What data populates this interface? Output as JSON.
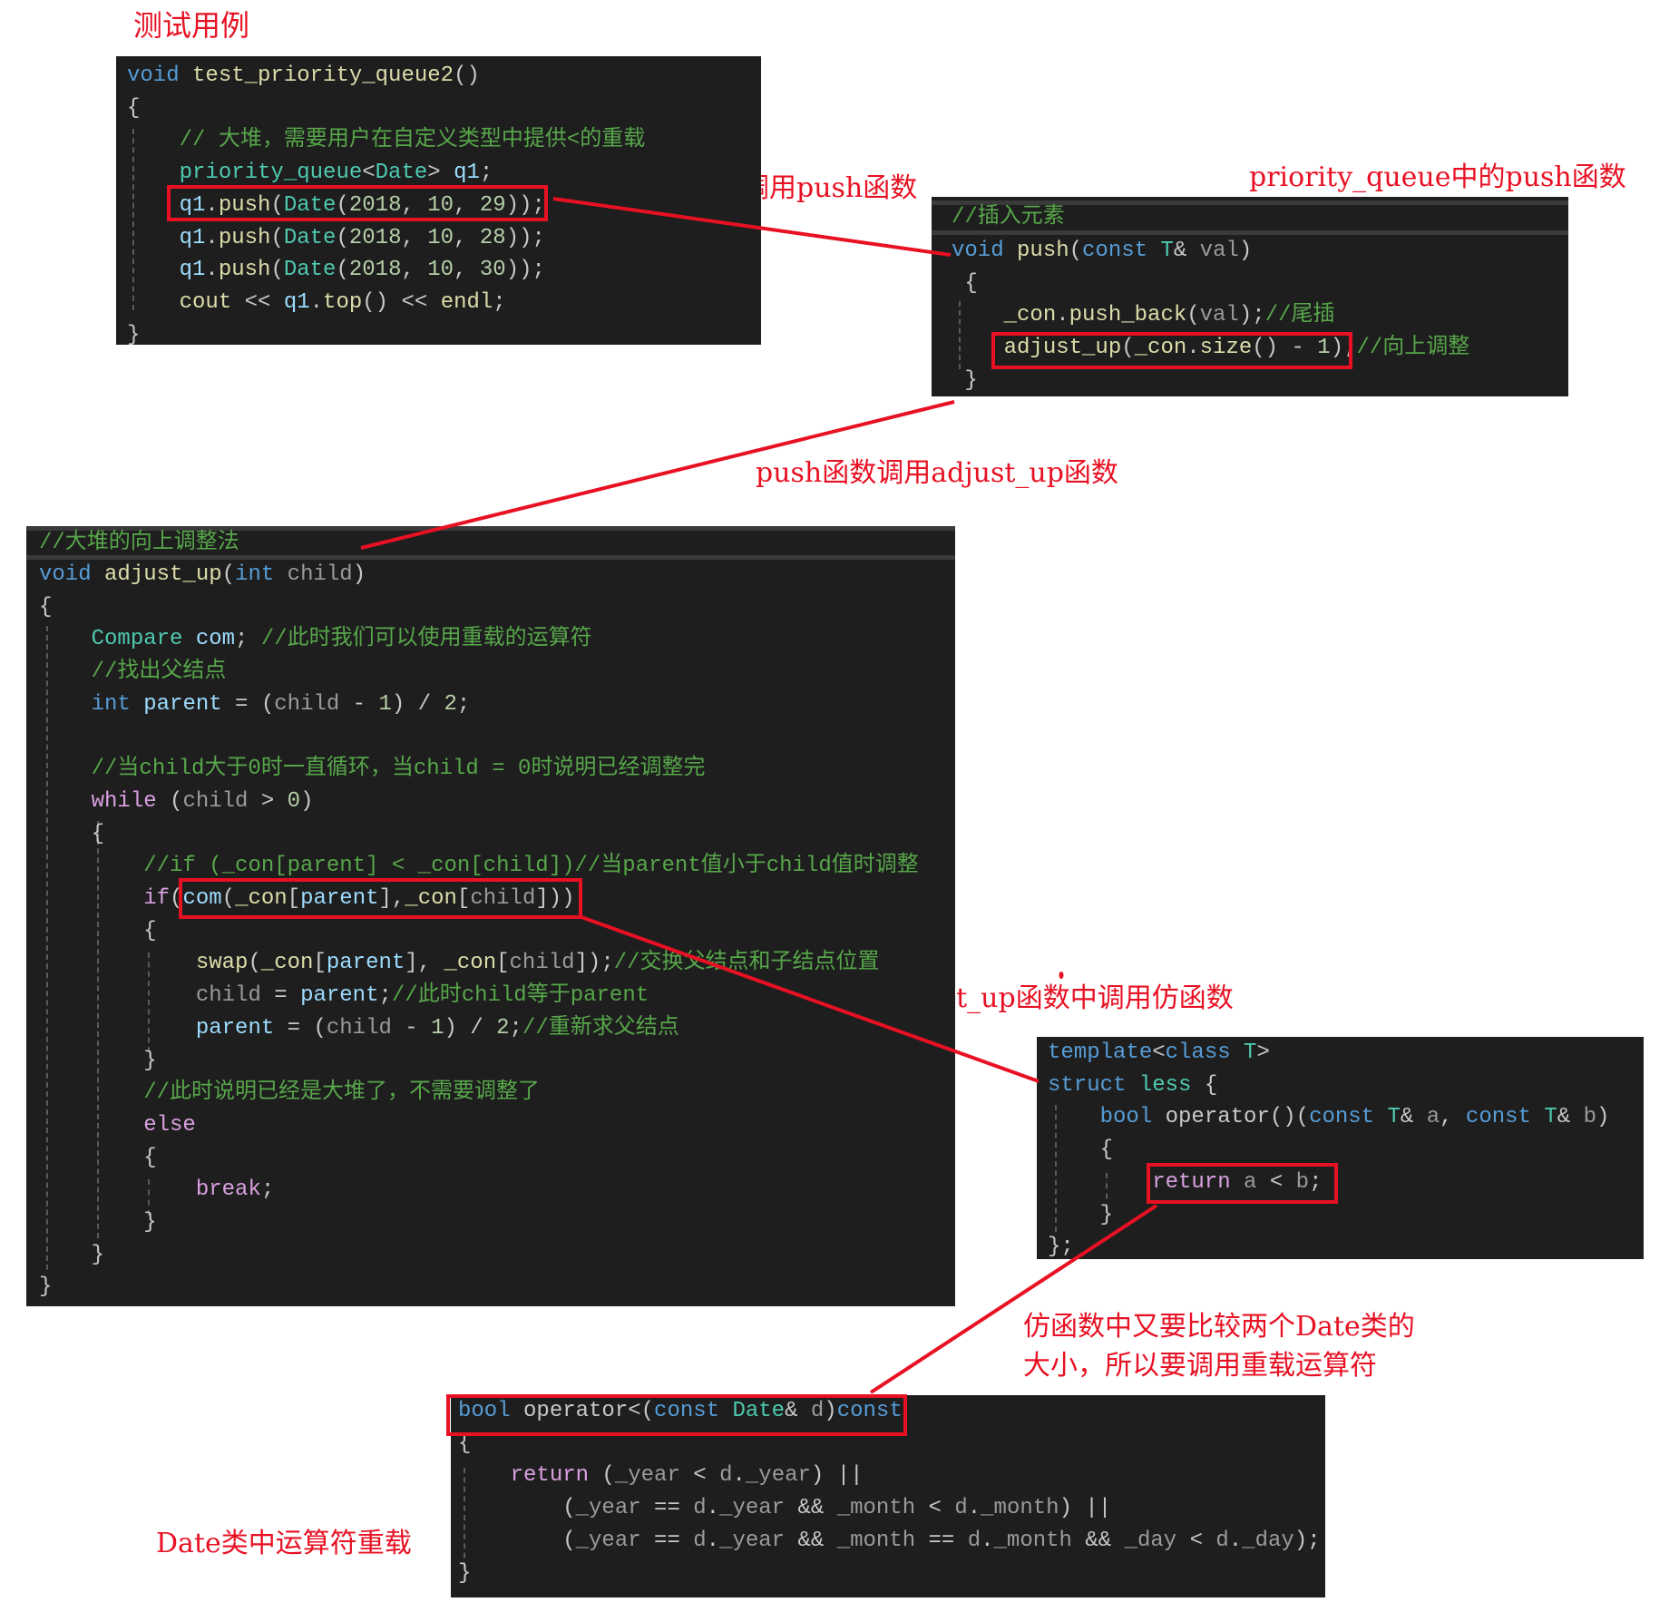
{
  "annotations": {
    "test_case_title": "测试用例",
    "push_call_note": "插入时候调用push函数",
    "push_in_pq_note": "priority_queue中的push函数",
    "push_calls_adjust_note": "push函数调用adjust_up函数",
    "adjust_calls_functor_note": "adjust_up函数中调用仿函数",
    "functor_compare_note_line1": "仿函数中又要比较两个Date类的",
    "functor_compare_note_line2": "大小，所以要调用重载运算符",
    "date_operator_note": "Date类中运算符重载"
  },
  "colors": {
    "annotation_red": "#e81123",
    "code_background": "#1e1e1e",
    "keyword_blue": "#569cd6",
    "type_teal": "#4ec9b0",
    "function_yellow": "#dcdcaa",
    "comment_green": "#57a64a",
    "control_purple": "#d8a0df",
    "variable_lightblue": "#9cdcfe"
  },
  "test_panel": {
    "lines": [
      [
        {
          "t": "void",
          "c": "kw"
        },
        {
          "t": " test_priority_queue2",
          "c": "fn"
        },
        {
          "t": "()",
          "c": "pl"
        }
      ],
      [
        {
          "t": "{",
          "c": "pl"
        }
      ],
      [
        {
          "t": "    // 大堆，需要用户在自定义类型中提供<的重载",
          "c": "cm"
        }
      ],
      [
        {
          "t": "    priority_queue",
          "c": "ty"
        },
        {
          "t": "<",
          "c": "pl"
        },
        {
          "t": "Date",
          "c": "ty"
        },
        {
          "t": "> ",
          "c": "pl"
        },
        {
          "t": "q1",
          "c": "var"
        },
        {
          "t": ";",
          "c": "pl"
        }
      ],
      [
        {
          "t": "    q1",
          "c": "var"
        },
        {
          "t": ".",
          "c": "pl"
        },
        {
          "t": "push",
          "c": "fn"
        },
        {
          "t": "(",
          "c": "pl"
        },
        {
          "t": "Date",
          "c": "ty"
        },
        {
          "t": "(",
          "c": "pl"
        },
        {
          "t": "2018",
          "c": "num"
        },
        {
          "t": ", ",
          "c": "pl"
        },
        {
          "t": "10",
          "c": "num"
        },
        {
          "t": ", ",
          "c": "pl"
        },
        {
          "t": "29",
          "c": "num"
        },
        {
          "t": "));",
          "c": "pl"
        }
      ],
      [
        {
          "t": "    q1",
          "c": "var"
        },
        {
          "t": ".",
          "c": "pl"
        },
        {
          "t": "push",
          "c": "fn"
        },
        {
          "t": "(",
          "c": "pl"
        },
        {
          "t": "Date",
          "c": "ty"
        },
        {
          "t": "(",
          "c": "pl"
        },
        {
          "t": "2018",
          "c": "num"
        },
        {
          "t": ", ",
          "c": "pl"
        },
        {
          "t": "10",
          "c": "num"
        },
        {
          "t": ", ",
          "c": "pl"
        },
        {
          "t": "28",
          "c": "num"
        },
        {
          "t": "));",
          "c": "pl"
        }
      ],
      [
        {
          "t": "    q1",
          "c": "var"
        },
        {
          "t": ".",
          "c": "pl"
        },
        {
          "t": "push",
          "c": "fn"
        },
        {
          "t": "(",
          "c": "pl"
        },
        {
          "t": "Date",
          "c": "ty"
        },
        {
          "t": "(",
          "c": "pl"
        },
        {
          "t": "2018",
          "c": "num"
        },
        {
          "t": ", ",
          "c": "pl"
        },
        {
          "t": "10",
          "c": "num"
        },
        {
          "t": ", ",
          "c": "pl"
        },
        {
          "t": "30",
          "c": "num"
        },
        {
          "t": "));",
          "c": "pl"
        }
      ],
      [
        {
          "t": "    cout",
          "c": "fn"
        },
        {
          "t": " << ",
          "c": "pl"
        },
        {
          "t": "q1",
          "c": "var"
        },
        {
          "t": ".",
          "c": "pl"
        },
        {
          "t": "top",
          "c": "fn"
        },
        {
          "t": "() << ",
          "c": "pl"
        },
        {
          "t": "endl",
          "c": "fn"
        },
        {
          "t": ";",
          "c": "pl"
        }
      ],
      [
        {
          "t": "}",
          "c": "pl"
        }
      ]
    ]
  },
  "push_panel": {
    "header_comment": "//插入元素",
    "lines": [
      [
        {
          "t": "void",
          "c": "kw"
        },
        {
          "t": " push",
          "c": "fn"
        },
        {
          "t": "(",
          "c": "pl"
        },
        {
          "t": "const",
          "c": "kw"
        },
        {
          "t": " T",
          "c": "ty"
        },
        {
          "t": "& ",
          "c": "pl"
        },
        {
          "t": "val",
          "c": "grayv"
        },
        {
          "t": ")",
          "c": "pl"
        }
      ],
      [
        {
          "t": " {",
          "c": "pl"
        }
      ],
      [
        {
          "t": "    _con",
          "c": "fn"
        },
        {
          "t": ".",
          "c": "pl"
        },
        {
          "t": "push_back",
          "c": "fn"
        },
        {
          "t": "(",
          "c": "pl"
        },
        {
          "t": "val",
          "c": "grayv"
        },
        {
          "t": ");",
          "c": "pl"
        },
        {
          "t": "//尾插",
          "c": "cm"
        }
      ],
      [
        {
          "t": "    adjust_up",
          "c": "fn"
        },
        {
          "t": "(",
          "c": "pl"
        },
        {
          "t": "_con",
          "c": "fn"
        },
        {
          "t": ".",
          "c": "pl"
        },
        {
          "t": "size",
          "c": "fn"
        },
        {
          "t": "() - ",
          "c": "pl"
        },
        {
          "t": "1",
          "c": "num"
        },
        {
          "t": ");",
          "c": "pl"
        },
        {
          "t": "//向上调整",
          "c": "cm"
        }
      ],
      [
        {
          "t": " }",
          "c": "pl"
        }
      ]
    ]
  },
  "adjust_panel": {
    "header_comment": "//大堆的向上调整法",
    "lines": [
      [
        {
          "t": "void",
          "c": "kw"
        },
        {
          "t": " adjust_up",
          "c": "fn"
        },
        {
          "t": "(",
          "c": "pl"
        },
        {
          "t": "int",
          "c": "kw"
        },
        {
          "t": " child",
          "c": "grayv"
        },
        {
          "t": ")",
          "c": "pl"
        }
      ],
      [
        {
          "t": "{",
          "c": "pl"
        }
      ],
      [
        {
          "t": "    Compare",
          "c": "ty"
        },
        {
          "t": " com",
          "c": "var"
        },
        {
          "t": "; ",
          "c": "pl"
        },
        {
          "t": "//此时我们可以使用重载的运算符",
          "c": "cm"
        }
      ],
      [
        {
          "t": "    //找出父结点",
          "c": "cm"
        }
      ],
      [
        {
          "t": "    int",
          "c": "kw"
        },
        {
          "t": " parent",
          "c": "var"
        },
        {
          "t": " = (",
          "c": "pl"
        },
        {
          "t": "child",
          "c": "grayv"
        },
        {
          "t": " - ",
          "c": "pl"
        },
        {
          "t": "1",
          "c": "num"
        },
        {
          "t": ") / ",
          "c": "pl"
        },
        {
          "t": "2",
          "c": "num"
        },
        {
          "t": ";",
          "c": "pl"
        }
      ],
      [
        {
          "t": "",
          "c": "pl"
        }
      ],
      [
        {
          "t": "    //当child大于0时一直循环，当child = 0时说明已经调整完",
          "c": "cm"
        }
      ],
      [
        {
          "t": "    while",
          "c": "ctl"
        },
        {
          "t": " (",
          "c": "pl"
        },
        {
          "t": "child",
          "c": "grayv"
        },
        {
          "t": " > ",
          "c": "pl"
        },
        {
          "t": "0",
          "c": "num"
        },
        {
          "t": ")",
          "c": "pl"
        }
      ],
      [
        {
          "t": "    {",
          "c": "pl"
        }
      ],
      [
        {
          "t": "        //if (_con[parent] < _con[child])//当parent值小于child值时调整",
          "c": "cm"
        }
      ],
      [
        {
          "t": "        if",
          "c": "ctl"
        },
        {
          "t": "(",
          "c": "pl"
        },
        {
          "t": "com",
          "c": "var"
        },
        {
          "t": "(",
          "c": "pl"
        },
        {
          "t": "_con",
          "c": "fn"
        },
        {
          "t": "[",
          "c": "pl"
        },
        {
          "t": "parent",
          "c": "var"
        },
        {
          "t": "],",
          "c": "pl"
        },
        {
          "t": "_con",
          "c": "fn"
        },
        {
          "t": "[",
          "c": "pl"
        },
        {
          "t": "child",
          "c": "grayv"
        },
        {
          "t": "]))",
          "c": "pl"
        }
      ],
      [
        {
          "t": "        {",
          "c": "pl"
        }
      ],
      [
        {
          "t": "            swap",
          "c": "fn"
        },
        {
          "t": "(",
          "c": "pl"
        },
        {
          "t": "_con",
          "c": "fn"
        },
        {
          "t": "[",
          "c": "pl"
        },
        {
          "t": "parent",
          "c": "var"
        },
        {
          "t": "], ",
          "c": "pl"
        },
        {
          "t": "_con",
          "c": "fn"
        },
        {
          "t": "[",
          "c": "pl"
        },
        {
          "t": "child",
          "c": "grayv"
        },
        {
          "t": "]);",
          "c": "pl"
        },
        {
          "t": "//交换父结点和子结点位置",
          "c": "cm"
        }
      ],
      [
        {
          "t": "            child",
          "c": "grayv"
        },
        {
          "t": " = ",
          "c": "pl"
        },
        {
          "t": "parent",
          "c": "var"
        },
        {
          "t": ";",
          "c": "pl"
        },
        {
          "t": "//此时child等于parent",
          "c": "cm"
        }
      ],
      [
        {
          "t": "            parent",
          "c": "var"
        },
        {
          "t": " = (",
          "c": "pl"
        },
        {
          "t": "child",
          "c": "grayv"
        },
        {
          "t": " - ",
          "c": "pl"
        },
        {
          "t": "1",
          "c": "num"
        },
        {
          "t": ") / ",
          "c": "pl"
        },
        {
          "t": "2",
          "c": "num"
        },
        {
          "t": ";",
          "c": "pl"
        },
        {
          "t": "//重新求父结点",
          "c": "cm"
        }
      ],
      [
        {
          "t": "        }",
          "c": "pl"
        }
      ],
      [
        {
          "t": "        //此时说明已经是大堆了，不需要调整了",
          "c": "cm"
        }
      ],
      [
        {
          "t": "        else",
          "c": "ctl"
        }
      ],
      [
        {
          "t": "        {",
          "c": "pl"
        }
      ],
      [
        {
          "t": "            break",
          "c": "ctl"
        },
        {
          "t": ";",
          "c": "pl"
        }
      ],
      [
        {
          "t": "        }",
          "c": "pl"
        }
      ],
      [
        {
          "t": "    }",
          "c": "pl"
        }
      ],
      [
        {
          "t": "}",
          "c": "pl"
        }
      ]
    ]
  },
  "less_panel": {
    "lines": [
      [
        {
          "t": "template",
          "c": "kw"
        },
        {
          "t": "<",
          "c": "pl"
        },
        {
          "t": "class",
          "c": "kw"
        },
        {
          "t": " T",
          "c": "ty"
        },
        {
          "t": ">",
          "c": "pl"
        }
      ],
      [
        {
          "t": "struct",
          "c": "kw"
        },
        {
          "t": " less",
          "c": "ty"
        },
        {
          "t": " {",
          "c": "pl"
        }
      ],
      [
        {
          "t": "    bool",
          "c": "kw"
        },
        {
          "t": " operator",
          "c": "pl"
        },
        {
          "t": "()(",
          "c": "pl"
        },
        {
          "t": "const",
          "c": "kw"
        },
        {
          "t": " T",
          "c": "ty"
        },
        {
          "t": "& ",
          "c": "pl"
        },
        {
          "t": "a",
          "c": "grayv"
        },
        {
          "t": ", ",
          "c": "pl"
        },
        {
          "t": "const",
          "c": "kw"
        },
        {
          "t": " T",
          "c": "ty"
        },
        {
          "t": "& ",
          "c": "pl"
        },
        {
          "t": "b",
          "c": "grayv"
        },
        {
          "t": ")",
          "c": "pl"
        }
      ],
      [
        {
          "t": "    {",
          "c": "pl"
        }
      ],
      [
        {
          "t": "        return",
          "c": "ctl"
        },
        {
          "t": " a",
          "c": "grayv"
        },
        {
          "t": " < ",
          "c": "pl"
        },
        {
          "t": "b",
          "c": "grayv"
        },
        {
          "t": ";",
          "c": "pl"
        }
      ],
      [
        {
          "t": "    }",
          "c": "pl"
        }
      ],
      [
        {
          "t": "};",
          "c": "pl"
        }
      ]
    ]
  },
  "operator_panel": {
    "lines": [
      [
        {
          "t": "bool",
          "c": "kw"
        },
        {
          "t": " operator",
          "c": "pl"
        },
        {
          "t": "<(",
          "c": "pl"
        },
        {
          "t": "const",
          "c": "kw"
        },
        {
          "t": " Date",
          "c": "ty"
        },
        {
          "t": "& ",
          "c": "pl"
        },
        {
          "t": "d",
          "c": "grayv"
        },
        {
          "t": ")",
          "c": "pl"
        },
        {
          "t": "const",
          "c": "kw"
        }
      ],
      [
        {
          "t": "{",
          "c": "pl"
        }
      ],
      [
        {
          "t": "    return",
          "c": "ctl"
        },
        {
          "t": " (",
          "c": "pl"
        },
        {
          "t": "_year",
          "c": "grayv"
        },
        {
          "t": " < ",
          "c": "pl"
        },
        {
          "t": "d",
          "c": "grayv"
        },
        {
          "t": ".",
          "c": "pl"
        },
        {
          "t": "_year",
          "c": "grayv"
        },
        {
          "t": ") ||",
          "c": "pl"
        }
      ],
      [
        {
          "t": "        (",
          "c": "pl"
        },
        {
          "t": "_year",
          "c": "grayv"
        },
        {
          "t": " == ",
          "c": "pl"
        },
        {
          "t": "d",
          "c": "grayv"
        },
        {
          "t": ".",
          "c": "pl"
        },
        {
          "t": "_year",
          "c": "grayv"
        },
        {
          "t": " && ",
          "c": "pl"
        },
        {
          "t": "_month",
          "c": "grayv"
        },
        {
          "t": " < ",
          "c": "pl"
        },
        {
          "t": "d",
          "c": "grayv"
        },
        {
          "t": ".",
          "c": "pl"
        },
        {
          "t": "_month",
          "c": "grayv"
        },
        {
          "t": ") ||",
          "c": "pl"
        }
      ],
      [
        {
          "t": "        (",
          "c": "pl"
        },
        {
          "t": "_year",
          "c": "grayv"
        },
        {
          "t": " == ",
          "c": "pl"
        },
        {
          "t": "d",
          "c": "grayv"
        },
        {
          "t": ".",
          "c": "pl"
        },
        {
          "t": "_year",
          "c": "grayv"
        },
        {
          "t": " && ",
          "c": "pl"
        },
        {
          "t": "_month",
          "c": "grayv"
        },
        {
          "t": " == ",
          "c": "pl"
        },
        {
          "t": "d",
          "c": "grayv"
        },
        {
          "t": ".",
          "c": "pl"
        },
        {
          "t": "_month",
          "c": "grayv"
        },
        {
          "t": " && ",
          "c": "pl"
        },
        {
          "t": "_day",
          "c": "grayv"
        },
        {
          "t": " < ",
          "c": "pl"
        },
        {
          "t": "d",
          "c": "grayv"
        },
        {
          "t": ".",
          "c": "pl"
        },
        {
          "t": "_day",
          "c": "grayv"
        },
        {
          "t": ");",
          "c": "pl"
        }
      ],
      [
        {
          "t": "}",
          "c": "pl"
        }
      ]
    ]
  }
}
